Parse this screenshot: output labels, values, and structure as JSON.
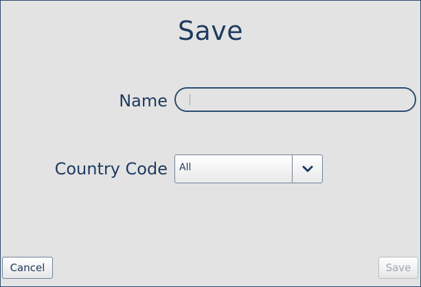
{
  "dialog": {
    "title": "Save"
  },
  "form": {
    "name_label": "Name",
    "name_value": "",
    "country_code_label": "Country Code",
    "country_code_selected": "All"
  },
  "actions": {
    "cancel_label": "Cancel",
    "save_label": "Save",
    "save_enabled": false
  },
  "icons": {
    "dropdown": "chevron-down-icon"
  },
  "colors": {
    "text": "#1e3a5f",
    "background": "#e3e3e3",
    "border": "#2a4a6e",
    "disabled_text": "#a0a7b0"
  }
}
